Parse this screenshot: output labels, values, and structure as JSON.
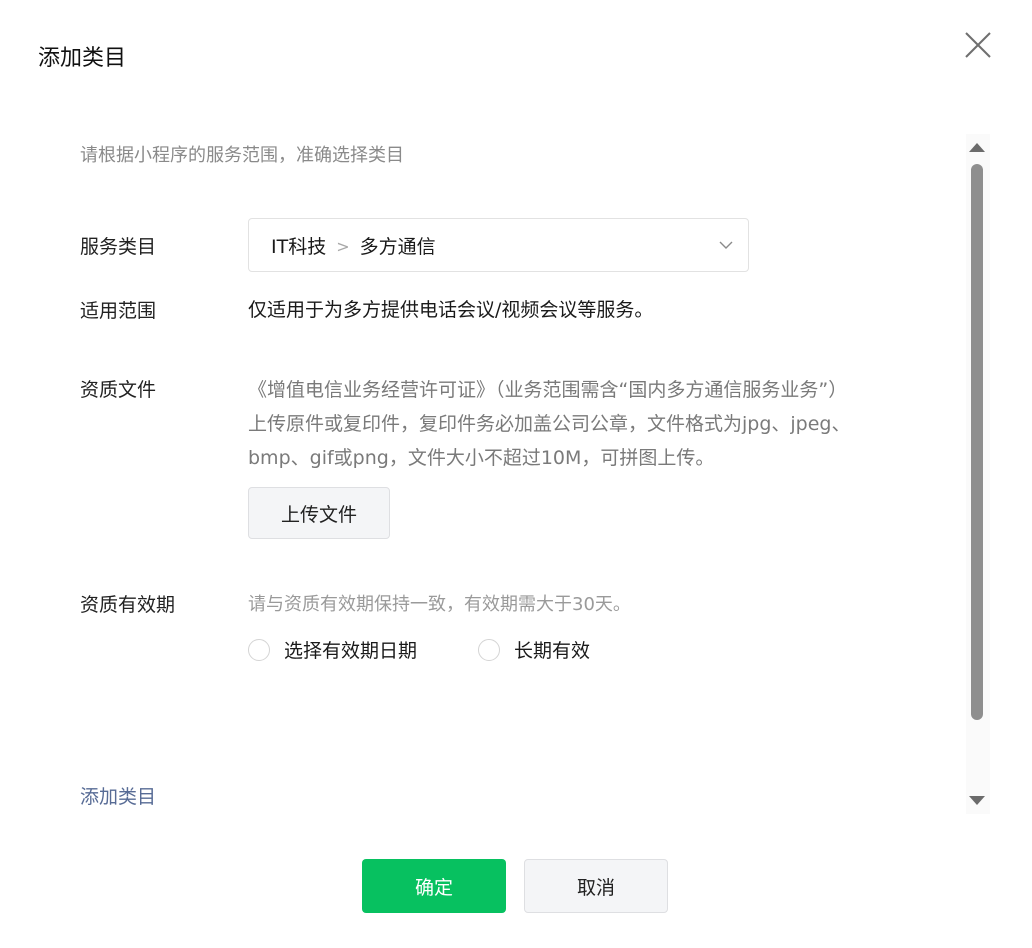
{
  "dialog": {
    "title": "添加类目"
  },
  "intro_text": "请根据小程序的服务范围，准确选择类目",
  "service_category": {
    "label": "服务类目",
    "level1": "IT科技",
    "separator": ">",
    "level2": "多方通信"
  },
  "scope": {
    "label": "适用范围",
    "text": "仅适用于为多方提供电话会议/视频会议等服务。"
  },
  "qualification": {
    "label": "资质文件",
    "desc_lines": [
      "《增值电信业务经营许可证》（业务范围需含“国内多方通信服务业务”）",
      "上传原件或复印件，复印件务必加盖公司公章，文件格式为jpg、jpeg、",
      "bmp、gif或png，文件大小不超过10M，可拼图上传。"
    ],
    "upload_label": "上传文件"
  },
  "validity": {
    "label": "资质有效期",
    "hint": "请与资质有效期保持一致，有效期需大于30天。",
    "options": [
      "选择有效期日期",
      "长期有效"
    ]
  },
  "add_category_link": "添加类目",
  "footer": {
    "confirm_label": "确定",
    "cancel_label": "取消"
  },
  "colors": {
    "primary": "#07c160",
    "link": "#576b95",
    "hint": "#9a9a9a"
  },
  "icons": {
    "close": "close-icon",
    "dropdown": "chevron-down-icon",
    "scroll_up": "arrow-up-icon",
    "scroll_down": "arrow-down-icon"
  }
}
